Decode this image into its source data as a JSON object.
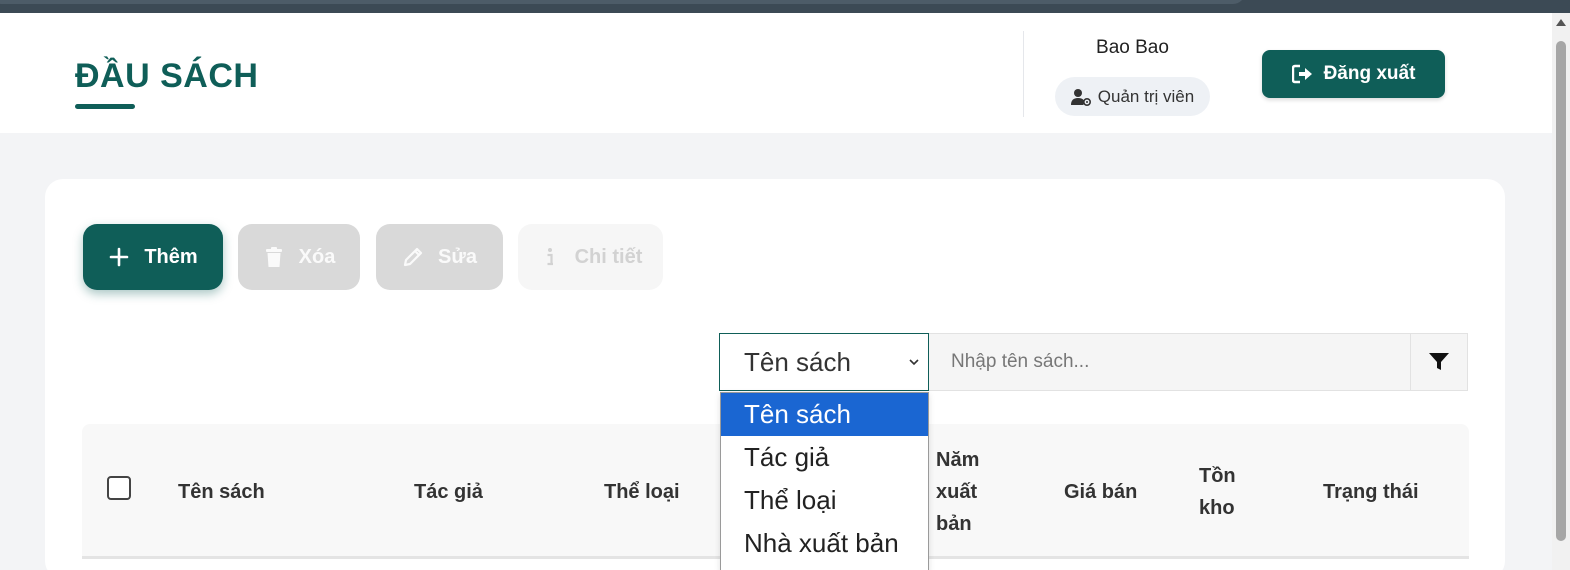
{
  "header": {
    "title": "ĐẦU SÁCH",
    "user_name": "Bao Bao",
    "role": "Quản trị viên",
    "logout_label": "Đăng xuất"
  },
  "toolbar": {
    "add_label": "Thêm",
    "delete_label": "Xóa",
    "edit_label": "Sửa",
    "detail_label": "Chi tiết"
  },
  "search": {
    "selected_field": "Tên sách",
    "placeholder": "Nhập tên sách...",
    "options": [
      "Tên sách",
      "Tác giả",
      "Thể loại",
      "Nhà xuất bản"
    ]
  },
  "table": {
    "columns": [
      "Tên sách",
      "Tác giả",
      "Thể loại",
      "Năm xuất bản",
      "Giá bán",
      "Tồn kho",
      "Trạng thái"
    ],
    "col_lines": {
      "nam_1": "Năm",
      "nam_2": "xuất",
      "nam_3": "bản",
      "ton_1": "Tồn",
      "ton_2": "kho"
    }
  },
  "colors": {
    "primary": "#0f5e58",
    "disabled": "#d9d9d9",
    "dropdown_selected": "#1a66d2"
  }
}
